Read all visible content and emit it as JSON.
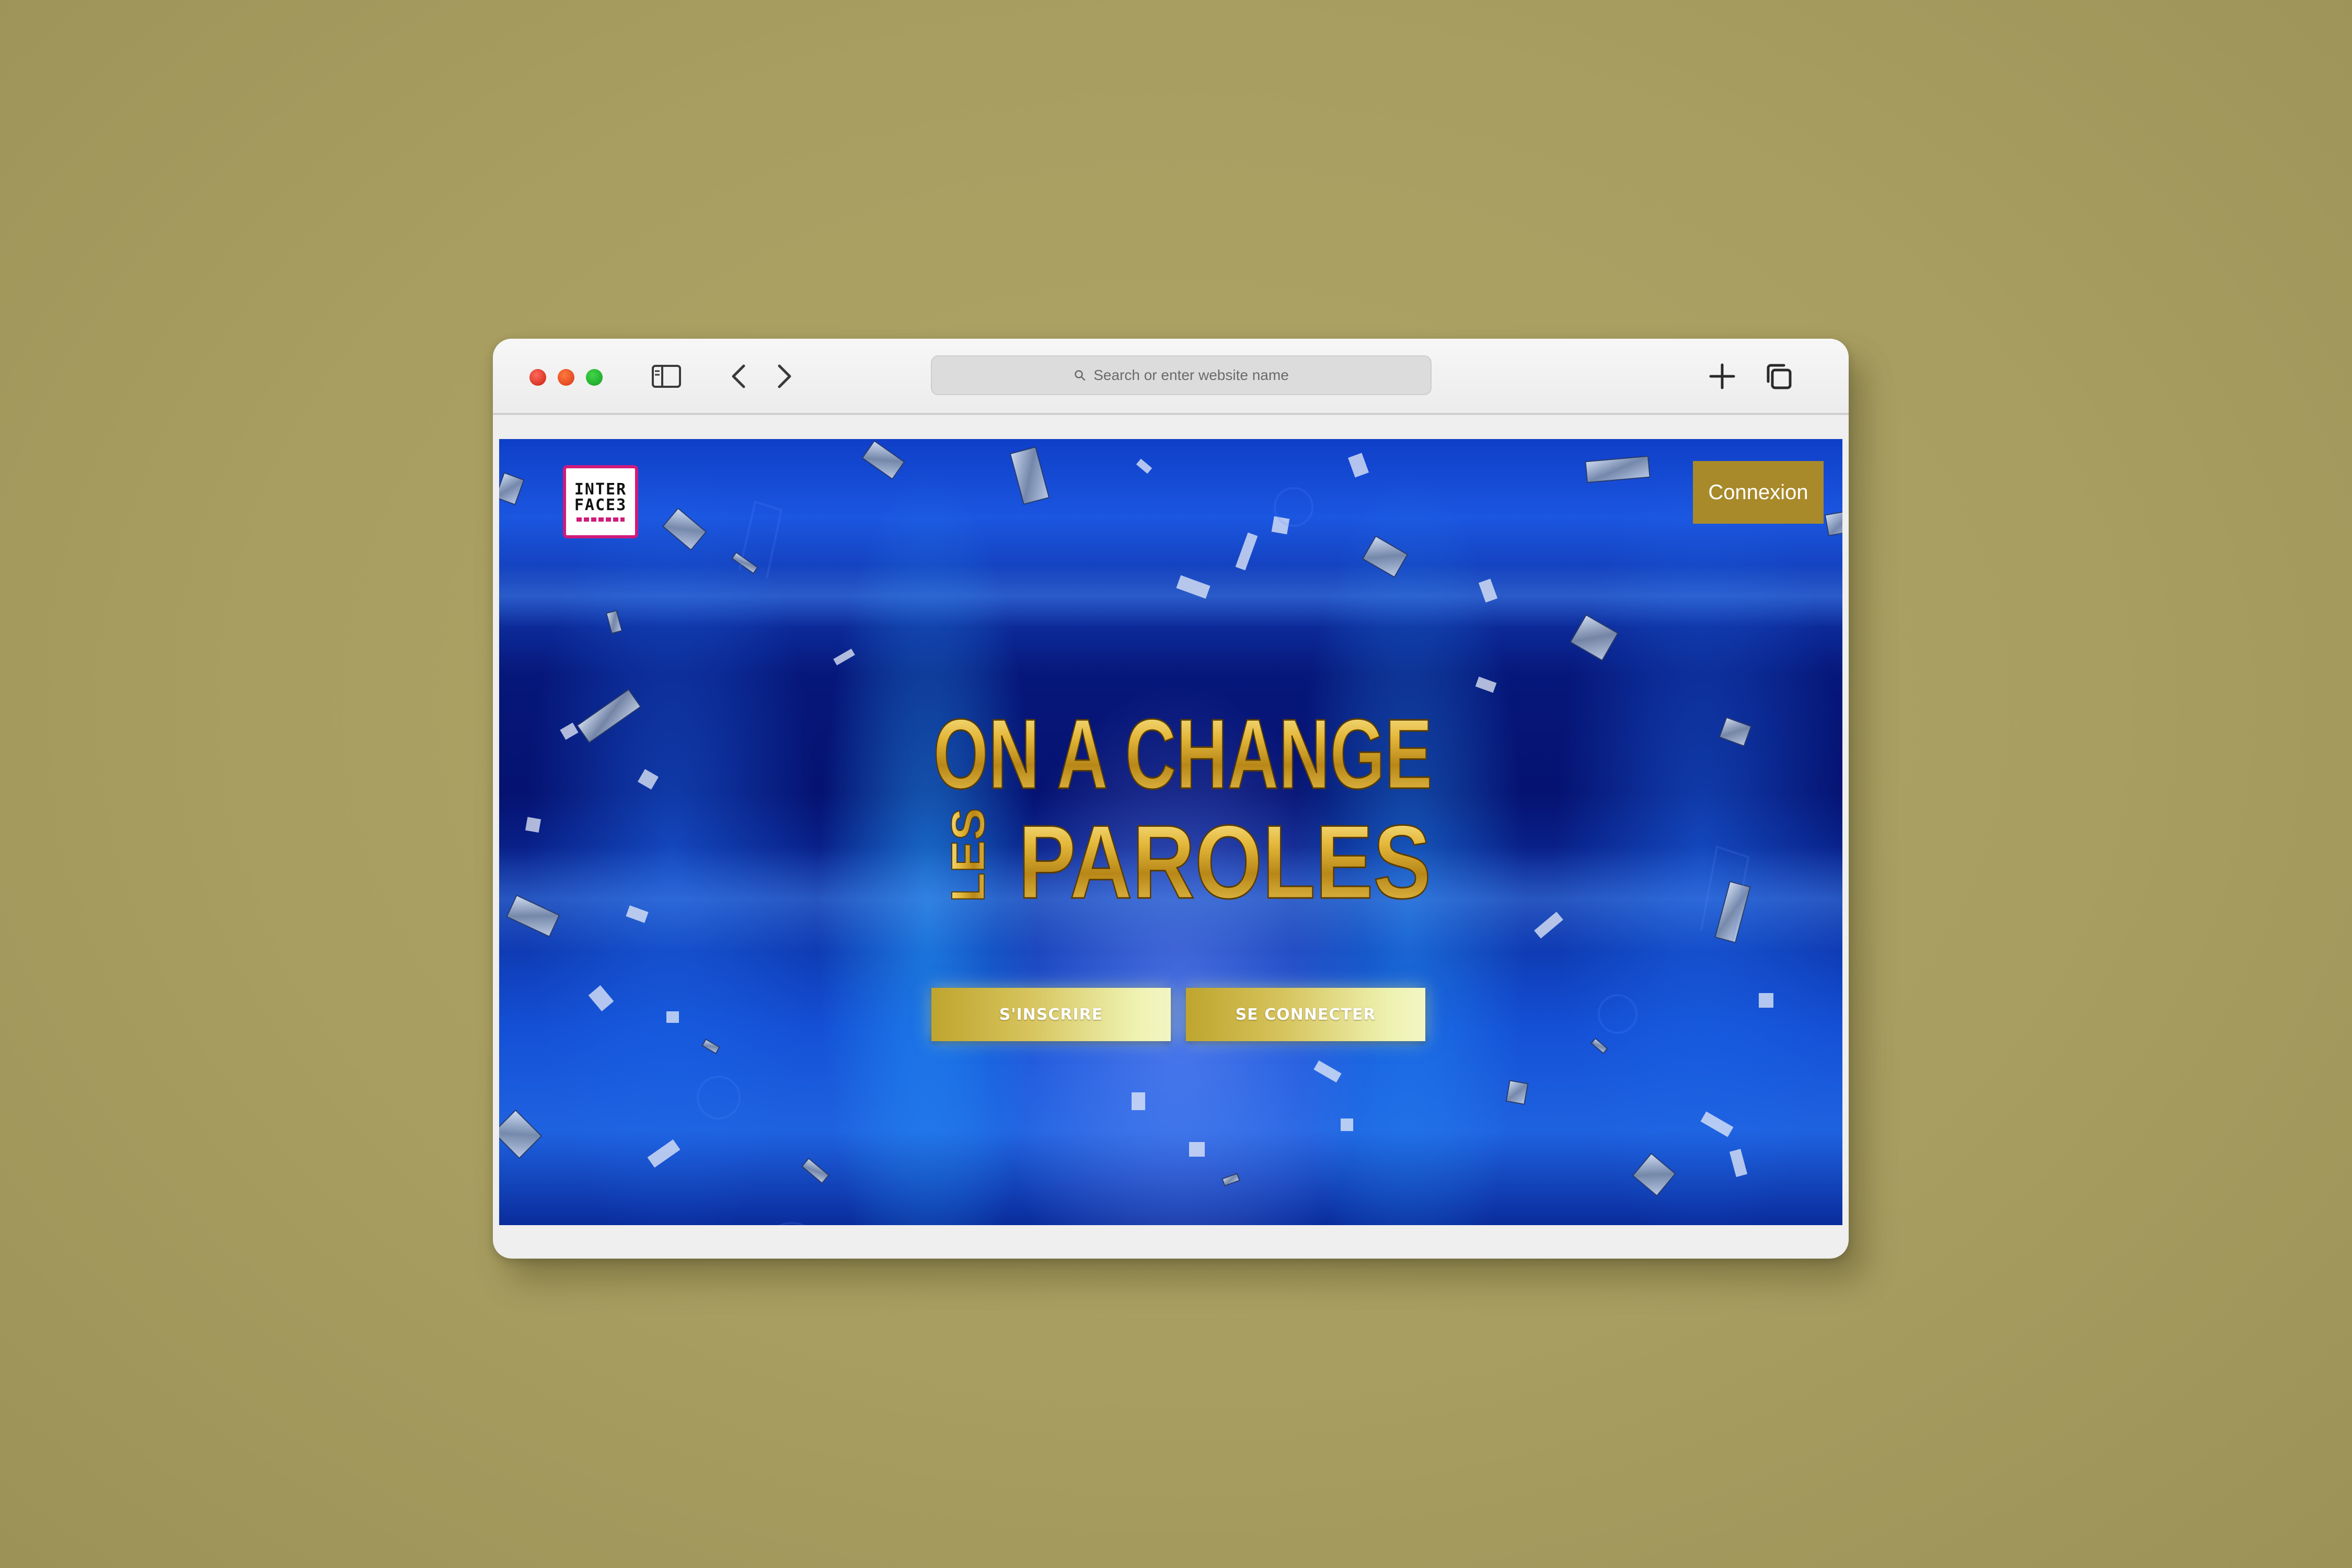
{
  "browser": {
    "address_placeholder": "Search or enter website name",
    "icons": [
      "sidebar-icon",
      "back-icon",
      "forward-icon",
      "new-tab-icon",
      "tabs-overview-icon"
    ]
  },
  "site": {
    "logo_line1": "INTER",
    "logo_line2": "FACE3",
    "header": {
      "login_label": "Connexion"
    },
    "hero": {
      "title_line1": "ON A CHANGE",
      "title_prefix": "LES",
      "title_line2": "PAROLES"
    },
    "actions": {
      "register_label": "S'INSCRIRE",
      "login_label": "SE CONNECTER"
    }
  },
  "colors": {
    "background": "#a89e61",
    "hero_blue": "#06177a",
    "gold": "#a88a2b",
    "logo_border": "#d01a7a"
  }
}
